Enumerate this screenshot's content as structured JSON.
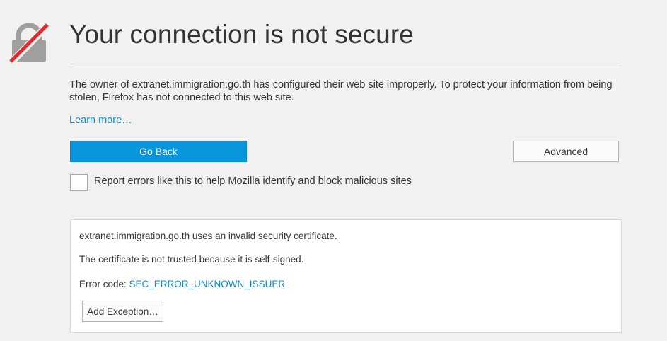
{
  "page": {
    "title": "Your connection is not secure",
    "description": "The owner of extranet.immigration.go.th has configured their web site improperly. To protect your information from being stolen, Firefox has not connected to this web site.",
    "learn_more_label": "Learn more…",
    "icon": "broken-lock-icon"
  },
  "actions": {
    "go_back_label": "Go Back",
    "advanced_label": "Advanced"
  },
  "report": {
    "checked": false,
    "label": "Report errors like this to help Mozilla identify and block malicious sites"
  },
  "details": {
    "cert_invalid": "extranet.immigration.go.th uses an invalid security certificate.",
    "cert_reason": "The certificate is not trusted because it is self-signed.",
    "error_code_label": "Error code: ",
    "error_code": "SEC_ERROR_UNKNOWN_ISSUER",
    "add_exception_label": "Add Exception…"
  },
  "colors": {
    "background": "#f1f1f1",
    "primary_button": "#0996dd",
    "link": "#0a8dc9",
    "lock_gray": "#9f9f9f",
    "slash_red": "#d92d2d"
  }
}
